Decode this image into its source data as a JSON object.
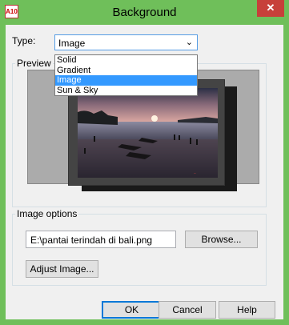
{
  "window": {
    "title": "Background",
    "app_icon": "A10",
    "close_glyph": "✕"
  },
  "type_field": {
    "label": "Type:",
    "value": "Image",
    "options": [
      "Solid",
      "Gradient",
      "Image",
      "Sun & Sky"
    ],
    "selected_index": 2
  },
  "preview": {
    "label": "Preview"
  },
  "image_options": {
    "label": "Image options",
    "file_path": "E:\\pantai terindah di bali.png",
    "browse_label": "Browse...",
    "adjust_label": "Adjust Image..."
  },
  "buttons": {
    "ok": "OK",
    "cancel": "Cancel",
    "help": "Help"
  },
  "colors": {
    "titlebar": "#6fbf5a",
    "close": "#c7403a",
    "selection": "#3399ff"
  }
}
